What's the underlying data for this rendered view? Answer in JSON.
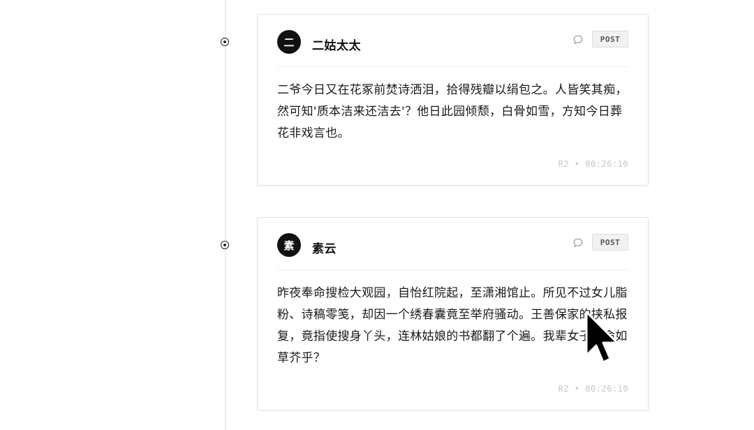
{
  "posts": [
    {
      "avatar_char": "二",
      "author": "二姑太太",
      "post_label": "POST",
      "content": "二爷今日又在花冢前焚诗洒泪，拾得残瓣以绢包之。人皆笑其痴，然可知'质本洁来还洁去'？他日此园倾颓，白骨如雪，方知今日葬花非戏言也。",
      "meta": "R2 • 00:26:10"
    },
    {
      "avatar_char": "素",
      "author": "素云",
      "post_label": "POST",
      "content": "昨夜奉命搜检大观园，自怡红院起，至潇湘馆止。所见不过女儿脂粉、诗稿零笺，却因一个绣春囊竟至举府骚动。王善保家的挟私报复，竟指使搜身丫头，连林姑娘的书都翻了个遍。我辈女子，命如草芥乎？",
      "meta": "R2 • 00:26:10"
    }
  ],
  "icons": {
    "timeline_dot": "radio-dot-icon",
    "comment": "speech-bubble-icon",
    "cursor": "mouse-pointer-icon"
  },
  "colors": {
    "accent": "#111111",
    "border": "#e2e2e2",
    "meta": "#c6c6c6"
  }
}
